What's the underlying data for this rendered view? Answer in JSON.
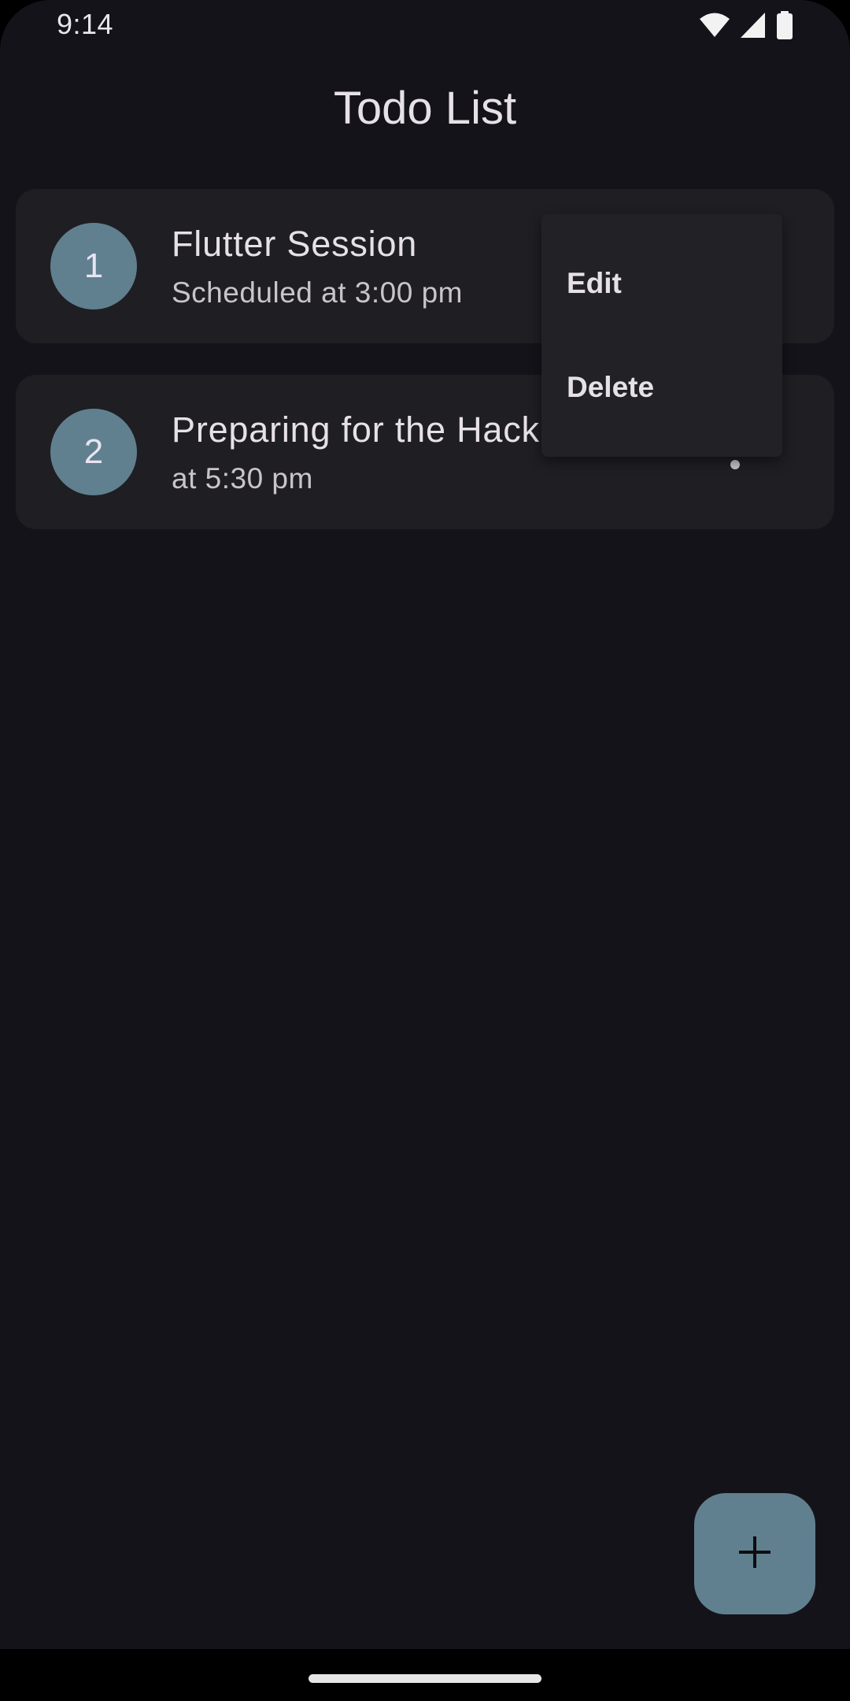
{
  "status_bar": {
    "time": "9:14",
    "icons": [
      "wifi-icon",
      "cell-signal-icon",
      "battery-icon"
    ]
  },
  "app_bar": {
    "title": "Todo List"
  },
  "todos": [
    {
      "number": "1",
      "title": "Flutter Session",
      "subtitle": "Scheduled at 3:00 pm"
    },
    {
      "number": "2",
      "title": "Preparing for the Hack",
      "subtitle": "at 5:30 pm"
    }
  ],
  "popup_menu": {
    "items": [
      {
        "label": "Edit"
      },
      {
        "label": "Delete"
      }
    ]
  },
  "fab": {
    "icon": "plus-icon"
  },
  "colors": {
    "background": "#15131a",
    "card": "#1f1e23",
    "accent": "#60808f",
    "text": "#e6e1e6"
  }
}
